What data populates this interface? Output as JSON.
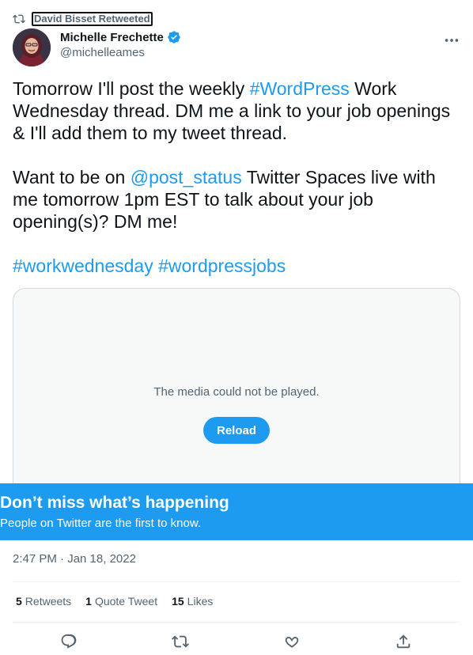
{
  "retweet": {
    "label": "David Bisset Retweeted",
    "icon": "retweet-icon"
  },
  "author": {
    "name": "Michelle Frechette",
    "handle": "@michelleames",
    "verified_icon": "verified-badge-icon",
    "more_icon": "more-icon"
  },
  "tweet": {
    "p1_a": "Tomorrow I'll post the weekly ",
    "p1_hashtag": "#WordPress",
    "p1_b": " Work Wednesday thread. DM me a link to your job openings & I'll add them to my tweet thread.",
    "p2_a": "Want to be on ",
    "p2_mention": "@post_status",
    "p2_b": " Twitter Spaces live with me tomorrow 1pm EST to talk about your job opening(s)? DM me!",
    "tag1": "#workwednesday",
    "tag2": "#wordpressjobs"
  },
  "media": {
    "message": "The media could not be played.",
    "reload_label": "Reload"
  },
  "banner": {
    "title": "Don’t miss what’s happening",
    "subtitle": "People on Twitter are the first to know."
  },
  "timestamp": "2:47 PM · Jan 18, 2022",
  "stats": {
    "retweets_count": "5",
    "retweets_label": "Retweets",
    "quotes_count": "1",
    "quotes_label": "Quote Tweet",
    "likes_count": "15",
    "likes_label": "Likes"
  },
  "actions": {
    "reply_icon": "reply-icon",
    "retweet_icon": "retweet-icon",
    "like_icon": "like-icon",
    "share_icon": "share-icon"
  },
  "colors": {
    "accent": "#1d9bf0",
    "text": "#0f1419",
    "muted": "#536471",
    "border": "#cfd9de"
  }
}
